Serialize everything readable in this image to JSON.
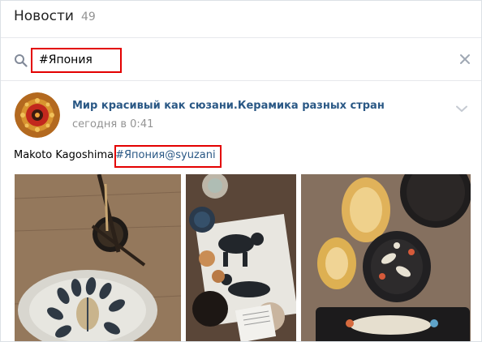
{
  "header": {
    "title": "Новости",
    "count": "49"
  },
  "search": {
    "query": "#Япония"
  },
  "icons": {
    "search": "search-icon",
    "clear": "close-icon",
    "more": "chevron-down-icon"
  },
  "post": {
    "author": "Мир красивый как сюзани.Керамика разных стран",
    "date": "сегодня в 0:41",
    "text_plain": "Makoto Kagoshima",
    "text_link": "#Япония@syuzani",
    "photo_count": 3
  },
  "colors": {
    "link": "#2a5885",
    "muted": "#939393",
    "highlight_border": "#e30000",
    "divider": "#e7e8ec"
  }
}
